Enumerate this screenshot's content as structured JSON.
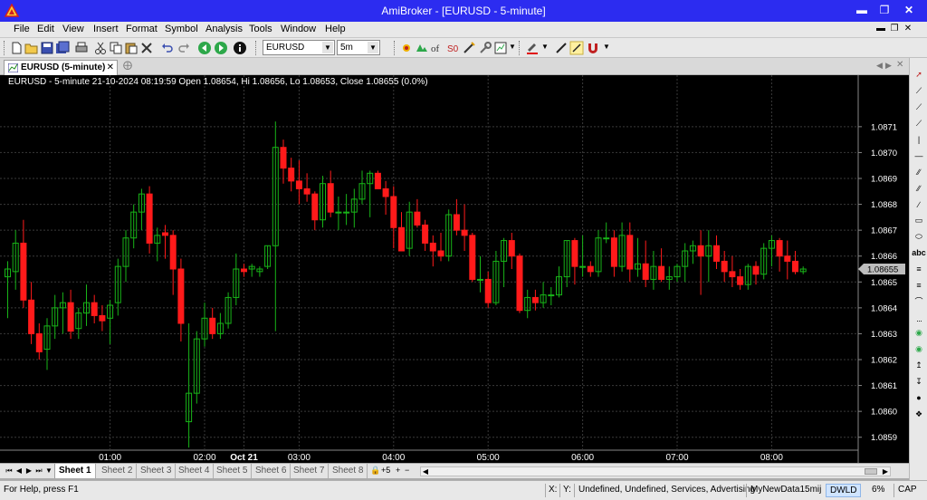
{
  "window": {
    "title": "AmiBroker - [EURUSD -  5-minute]"
  },
  "menu": [
    "File",
    "Edit",
    "View",
    "Insert",
    "Format",
    "Symbol",
    "Analysis",
    "Tools",
    "Window",
    "Help"
  ],
  "toolbar": {
    "symbol": "EURUSD",
    "interval": "5m",
    "icons": [
      "new-icon",
      "open-icon",
      "save-icon",
      "save-all-icon",
      "print-icon",
      "cut-icon",
      "copy-icon",
      "paste-icon",
      "delete-icon",
      "undo-icon",
      "redo-icon",
      "back-icon",
      "forward-icon",
      "info-icon"
    ]
  },
  "document_tab": {
    "label": "EURUSD (5-minute)"
  },
  "chart": {
    "info_line": "EURUSD - 5-minute 21-10-2024 08:19:59 Open 1.08654, Hi 1.08656, Lo 1.08653, Close 1.08655 (0.0%)",
    "current_price_label": "1.08655",
    "colors": {
      "up": "#18b418",
      "down": "#ff1a1a",
      "background": "#000000",
      "grid": "#3a3a3a",
      "axis_text": "#ffffff"
    }
  },
  "chart_data": {
    "type": "candlestick",
    "symbol": "EURUSD",
    "interval": "5-minute",
    "y_ticks": [
      1.0859,
      1.086,
      1.0861,
      1.0862,
      1.0863,
      1.0864,
      1.0865,
      1.0866,
      1.0867,
      1.0868,
      1.0869,
      1.087,
      1.0871
    ],
    "y_tick_labels": [
      "1.0859",
      "1.0860",
      "1.0861",
      "1.0862",
      "1.0863",
      "1.0864",
      "1.0865",
      "1.0866",
      "1.0867",
      "1.0868",
      "1.0869",
      "1.0870",
      "1.0871"
    ],
    "ylim": [
      1.08585,
      1.08725
    ],
    "x_ticks": [
      {
        "bar": 13,
        "label": "01:00"
      },
      {
        "bar": 25,
        "label": "02:00"
      },
      {
        "bar": 30,
        "label": "Oct 21",
        "bold": true
      },
      {
        "bar": 37,
        "label": "03:00"
      },
      {
        "bar": 49,
        "label": "04:00"
      },
      {
        "bar": 61,
        "label": "05:00"
      },
      {
        "bar": 73,
        "label": "06:00"
      },
      {
        "bar": 85,
        "label": "07:00"
      },
      {
        "bar": 97,
        "label": "08:00"
      }
    ],
    "candles": [
      [
        1.08652,
        1.08658,
        1.08636,
        1.08655
      ],
      [
        1.08654,
        1.0867,
        1.08647,
        1.08665
      ],
      [
        1.08665,
        1.08674,
        1.0864,
        1.08643
      ],
      [
        1.08643,
        1.0865,
        1.08626,
        1.0863
      ],
      [
        1.0863,
        1.08634,
        1.0862,
        1.08623
      ],
      [
        1.08624,
        1.08636,
        1.08616,
        1.08633
      ],
      [
        1.08633,
        1.08645,
        1.08628,
        1.0864
      ],
      [
        1.0864,
        1.08646,
        1.0863,
        1.08642
      ],
      [
        1.08642,
        1.08647,
        1.08628,
        1.08631
      ],
      [
        1.08632,
        1.0864,
        1.08628,
        1.08638
      ],
      [
        1.08638,
        1.08649,
        1.08633,
        1.08642
      ],
      [
        1.08642,
        1.08645,
        1.08634,
        1.08637
      ],
      [
        1.08637,
        1.08641,
        1.08631,
        1.08635
      ],
      [
        1.08636,
        1.08643,
        1.08626,
        1.08641
      ],
      [
        1.08642,
        1.08659,
        1.08637,
        1.08656
      ],
      [
        1.08656,
        1.0867,
        1.0865,
        1.08667
      ],
      [
        1.08667,
        1.0868,
        1.08663,
        1.08677
      ],
      [
        1.08677,
        1.08686,
        1.0867,
        1.08684
      ],
      [
        1.08684,
        1.08687,
        1.08661,
        1.08665
      ],
      [
        1.08665,
        1.08671,
        1.08658,
        1.08668
      ],
      [
        1.08669,
        1.08672,
        1.08659,
        1.08668
      ],
      [
        1.08668,
        1.0867,
        1.08645,
        1.08655
      ],
      [
        1.08655,
        1.08659,
        1.08627,
        1.08634
      ],
      [
        1.08596,
        1.08634,
        1.08586,
        1.08607
      ],
      [
        1.08607,
        1.08631,
        1.08603,
        1.08628
      ],
      [
        1.08628,
        1.08642,
        1.08625,
        1.08636
      ],
      [
        1.08636,
        1.0864,
        1.08628,
        1.0863
      ],
      [
        1.0863,
        1.08638,
        1.08628,
        1.08634
      ],
      [
        1.08634,
        1.08646,
        1.08632,
        1.08644
      ],
      [
        1.08644,
        1.08661,
        1.08641,
        1.08655
      ],
      [
        1.08655,
        1.08657,
        1.08652,
        1.08654
      ],
      [
        1.08655,
        1.08657,
        1.08652,
        1.08656
      ],
      [
        1.08654,
        1.08656,
        1.08652,
        1.08655
      ],
      [
        1.08656,
        1.08664,
        1.08655,
        1.08664
      ],
      [
        1.08664,
        1.08712,
        1.08631,
        1.08702
      ],
      [
        1.08702,
        1.08705,
        1.08688,
        1.08694
      ],
      [
        1.08694,
        1.08698,
        1.08685,
        1.08689
      ],
      [
        1.08689,
        1.08697,
        1.0868,
        1.08686
      ],
      [
        1.08686,
        1.08692,
        1.08681,
        1.08684
      ],
      [
        1.08684,
        1.08685,
        1.0867,
        1.08674
      ],
      [
        1.08674,
        1.08691,
        1.08671,
        1.08688
      ],
      [
        1.08688,
        1.08693,
        1.08675,
        1.08677
      ],
      [
        1.08677,
        1.08683,
        1.0867,
        1.08677
      ],
      [
        1.08677,
        1.08684,
        1.08672,
        1.08677
      ],
      [
        1.08677,
        1.08686,
        1.08671,
        1.08682
      ],
      [
        1.08682,
        1.08693,
        1.0868,
        1.08688
      ],
      [
        1.08688,
        1.08693,
        1.08675,
        1.08692
      ],
      [
        1.08692,
        1.08693,
        1.08686,
        1.08686
      ],
      [
        1.08686,
        1.08689,
        1.08676,
        1.08683
      ],
      [
        1.08683,
        1.08687,
        1.08663,
        1.08671
      ],
      [
        1.08671,
        1.08677,
        1.08662,
        1.08662
      ],
      [
        1.08663,
        1.08681,
        1.0866,
        1.08677
      ],
      [
        1.08677,
        1.08682,
        1.08671,
        1.08672
      ],
      [
        1.08672,
        1.08674,
        1.08662,
        1.08665
      ],
      [
        1.08665,
        1.08668,
        1.08656,
        1.08662
      ],
      [
        1.08662,
        1.08669,
        1.08658,
        1.0866
      ],
      [
        1.0866,
        1.08678,
        1.08658,
        1.08676
      ],
      [
        1.08676,
        1.08682,
        1.08668,
        1.0867
      ],
      [
        1.0867,
        1.0868,
        1.08662,
        1.08668
      ],
      [
        1.08668,
        1.08669,
        1.0865,
        1.08651
      ],
      [
        1.08651,
        1.0866,
        1.08646,
        1.08651
      ],
      [
        1.08651,
        1.08654,
        1.0864,
        1.08642
      ],
      [
        1.08642,
        1.08662,
        1.08641,
        1.08658
      ],
      [
        1.08658,
        1.08667,
        1.08648,
        1.08666
      ],
      [
        1.08666,
        1.08669,
        1.08655,
        1.0866
      ],
      [
        1.0866,
        1.08661,
        1.08638,
        1.08639
      ],
      [
        1.08639,
        1.08647,
        1.08636,
        1.08644
      ],
      [
        1.08644,
        1.08647,
        1.08639,
        1.08642
      ],
      [
        1.08642,
        1.0865,
        1.0864,
        1.08645
      ],
      [
        1.08645,
        1.08648,
        1.08641,
        1.08645
      ],
      [
        1.08645,
        1.08656,
        1.08644,
        1.08652
      ],
      [
        1.08652,
        1.08666,
        1.08648,
        1.08666
      ],
      [
        1.08666,
        1.08667,
        1.08649,
        1.08656
      ],
      [
        1.08656,
        1.08668,
        1.08652,
        1.08656
      ],
      [
        1.08656,
        1.08658,
        1.08652,
        1.08654
      ],
      [
        1.08654,
        1.0867,
        1.08652,
        1.08667
      ],
      [
        1.08667,
        1.08673,
        1.08665,
        1.08667
      ],
      [
        1.08667,
        1.0867,
        1.08652,
        1.08656
      ],
      [
        1.08656,
        1.08673,
        1.08654,
        1.08668
      ],
      [
        1.08668,
        1.08673,
        1.0865,
        1.08655
      ],
      [
        1.08655,
        1.08667,
        1.08652,
        1.08657
      ],
      [
        1.08657,
        1.08666,
        1.08648,
        1.08651
      ],
      [
        1.08651,
        1.08662,
        1.08647,
        1.08656
      ],
      [
        1.08656,
        1.08663,
        1.0865,
        1.08651
      ],
      [
        1.08651,
        1.08656,
        1.08647,
        1.08652
      ],
      [
        1.08652,
        1.08657,
        1.0865,
        1.08656
      ],
      [
        1.08656,
        1.08665,
        1.0865,
        1.08662
      ],
      [
        1.08662,
        1.08666,
        1.08657,
        1.08664
      ],
      [
        1.08664,
        1.0867,
        1.08645,
        1.0866
      ],
      [
        1.0866,
        1.0867,
        1.0865,
        1.08664
      ],
      [
        1.08664,
        1.08668,
        1.08655,
        1.08658
      ],
      [
        1.08658,
        1.08662,
        1.0865,
        1.08654
      ],
      [
        1.08654,
        1.0866,
        1.08648,
        1.08652
      ],
      [
        1.08652,
        1.08655,
        1.08647,
        1.08649
      ],
      [
        1.08649,
        1.08657,
        1.08647,
        1.08656
      ],
      [
        1.08656,
        1.08658,
        1.08649,
        1.08653
      ],
      [
        1.08653,
        1.08665,
        1.08651,
        1.08663
      ],
      [
        1.08663,
        1.08668,
        1.08656,
        1.08666
      ],
      [
        1.08666,
        1.08667,
        1.08654,
        1.0866
      ],
      [
        1.0866,
        1.08666,
        1.08651,
        1.08658
      ],
      [
        1.08658,
        1.08662,
        1.08653,
        1.08654
      ],
      [
        1.08654,
        1.08656,
        1.08653,
        1.08655
      ]
    ]
  },
  "sheets": {
    "tabs": [
      "Sheet 1",
      "Sheet 2",
      "Sheet 3",
      "Sheet 4",
      "Sheet 5",
      "Sheet 6",
      "Sheet 7",
      "Sheet 8"
    ],
    "active": "Sheet 1",
    "extra": [
      "+5",
      "+"
    ]
  },
  "status": {
    "help": "For Help, press F1",
    "x_label": "X:",
    "y_label": "Y:",
    "categories": "Undefined, Undefined, Services, Advertising",
    "database": "MyNewData15mij",
    "mode": "DWLD",
    "zoom": "6%",
    "caps": "CAP"
  }
}
